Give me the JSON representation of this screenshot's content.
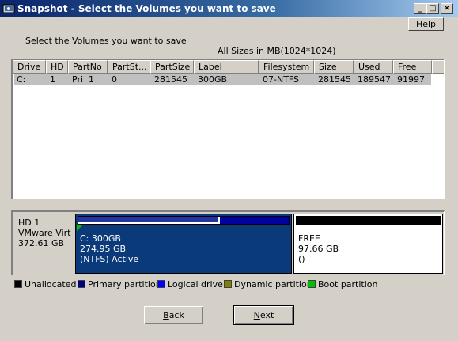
{
  "window": {
    "title": "Snapshot - Select the Volumes you want to save",
    "minimize_label": "_",
    "maximize_label": "□",
    "close_label": "×"
  },
  "help_label": "Help",
  "instruction": "Select the Volumes you want to save",
  "sizes_note": "All Sizes in MB(1024*1024)",
  "table": {
    "columns": [
      "Drive",
      "HD",
      "PartNo",
      "PartSt...",
      "PartSize",
      "Label",
      "Filesystem",
      "Size",
      "Used",
      "Free"
    ],
    "rows": [
      {
        "drive": "C:",
        "hd": "1",
        "partno": "Pri  1",
        "partst": "0",
        "partsize": "281545",
        "label": "300GB",
        "filesystem": "07-NTFS",
        "size": "281545",
        "used": "189547",
        "free": "91997"
      }
    ]
  },
  "disk": {
    "name": "HD 1",
    "model": "VMware Virt",
    "capacity": "372.61 GB",
    "partitions": [
      {
        "line1": "C: 300GB",
        "line2": "274.95 GB",
        "line3": "(NTFS) Active",
        "used_fraction": 0.673
      },
      {
        "line1": "FREE",
        "line2": "97.66 GB",
        "line3": "()"
      }
    ]
  },
  "legend": [
    {
      "label": "Unallocated",
      "color": "#000000"
    },
    {
      "label": "Primary partition",
      "color": "#000080"
    },
    {
      "label": "Logical drive",
      "color": "#0000ff"
    },
    {
      "label": "Dynamic partition",
      "color": "#808000"
    },
    {
      "label": "Boot partition",
      "color": "#00c000"
    }
  ],
  "buttons": {
    "back": "Back",
    "next": "Next"
  }
}
